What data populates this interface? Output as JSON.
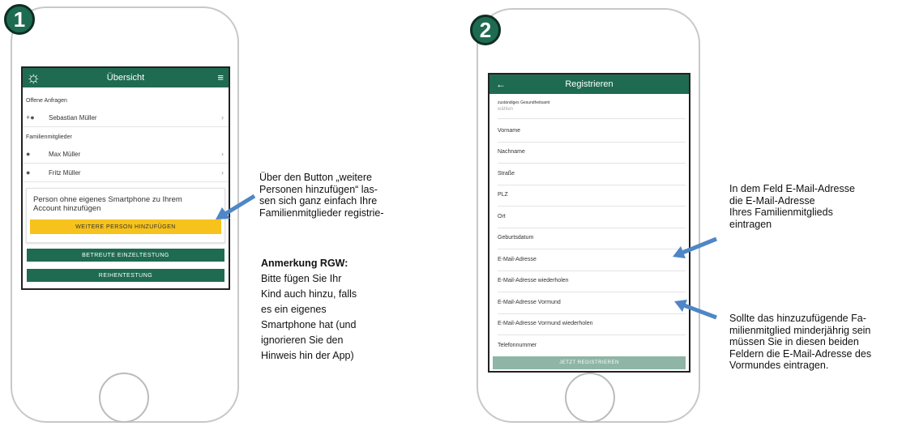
{
  "phone1": {
    "step": "1",
    "title": "Übersicht",
    "sun_icon": "sun-icon",
    "menu_icon": "hamburger-menu-icon",
    "open_requests_label": "Offene Anfragen",
    "open_requests": [
      {
        "name": "Sebastian Müller"
      }
    ],
    "family_label": "Familienmitglieder",
    "family_members": [
      {
        "name": "Max Müller"
      },
      {
        "name": "Fritz Müller"
      }
    ],
    "card_text": "Person ohne eigenes Smartphone zu Ihrem Account hinzufügen",
    "add_person_button": "WEITERE PERSON HINZUFÜGEN",
    "assisted_test_button": "BETREUTE EINZELTESTUNG",
    "series_test_button": "REIHENTESTUNG",
    "colors": {
      "primary": "#1e6b52",
      "accent": "#f7c21b"
    }
  },
  "phone2": {
    "step": "2",
    "title": "Registrieren",
    "back_icon": "back-arrow-icon",
    "health_office_label": "zuständiges Gesundheitsamt",
    "health_office_placeholder": "wählen",
    "fields": [
      "Vorname",
      "Nachname",
      "Straße",
      "PLZ",
      "Ort",
      "Geburtsdatum",
      "E-Mail-Adresse",
      "E-Mail-Adresse wiederholen",
      "E-Mail-Adresse Vormund",
      "E-Mail-Adresse Vormund wiederholen",
      "Telefonnummer"
    ],
    "register_button": "JETZT REGISTRIEREN",
    "colors": {
      "primary": "#1e6b52",
      "disabled": "#8fb5a6"
    }
  },
  "annotations": {
    "phone1_button_note": [
      "Über den Button „weitere",
      "Personen hinzufügen“ las-",
      "sen sich ganz einfach Ihre",
      "Familienmitglieder registrie-"
    ],
    "remark_title": "Anmerkung RGW:",
    "remark_lines": [
      "Bitte fügen Sie Ihr",
      "Kind auch hinzu, falls",
      "es ein eigenes",
      "Smartphone hat (und",
      "ignorieren Sie den",
      "Hinweis hin der App)"
    ],
    "email_note": [
      "In dem Feld E-Mail-Adresse",
      "die E-Mail-Adresse",
      "Ihres Familienmitglieds",
      "eintragen"
    ],
    "guardian_note": [
      "Sollte das hinzuzufügende Fa-",
      "milienmitglied minderjährig sein",
      "müssen Sie in diesen beiden",
      "Feldern die E-Mail-Adresse des",
      "Vormundes eintragen."
    ],
    "arrow_color": "#4f86c6"
  }
}
